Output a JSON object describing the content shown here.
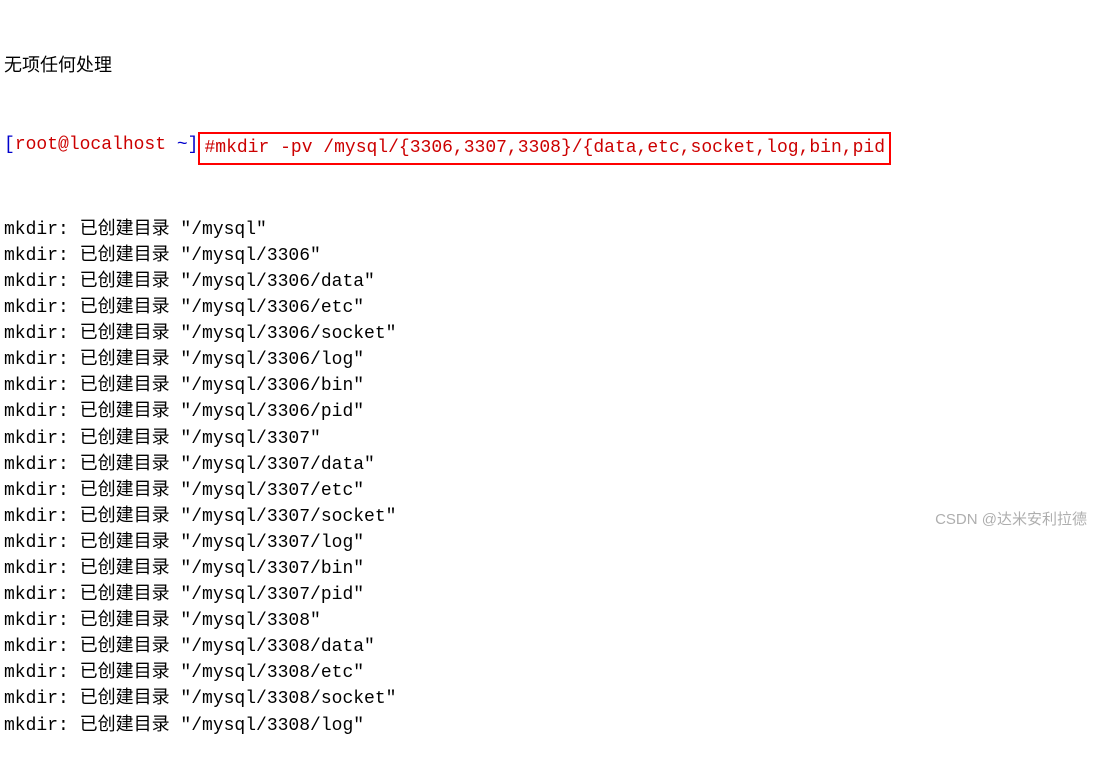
{
  "header": "无项任何处理",
  "prompt": {
    "open_bracket": "[",
    "user_host": "root@localhost",
    "tilde": " ~",
    "close_bracket": "]",
    "hash": "#",
    "command": "mkdir -pv /mysql/{3306,3307,3308}/{data,etc,socket,log,bin,pid"
  },
  "output_prefix": "mkdir: 已创建目录 ",
  "output_lines": [
    "\"/mysql\"",
    "\"/mysql/3306\"",
    "\"/mysql/3306/data\"",
    "\"/mysql/3306/etc\"",
    "\"/mysql/3306/socket\"",
    "\"/mysql/3306/log\"",
    "\"/mysql/3306/bin\"",
    "\"/mysql/3306/pid\"",
    "\"/mysql/3307\"",
    "\"/mysql/3307/data\"",
    "\"/mysql/3307/etc\"",
    "\"/mysql/3307/socket\"",
    "\"/mysql/3307/log\"",
    "\"/mysql/3307/bin\"",
    "\"/mysql/3307/pid\"",
    "\"/mysql/3308\"",
    "\"/mysql/3308/data\"",
    "\"/mysql/3308/etc\"",
    "\"/mysql/3308/socket\"",
    "\"/mysql/3308/log\""
  ],
  "watermark": "CSDN @达米安利拉德"
}
